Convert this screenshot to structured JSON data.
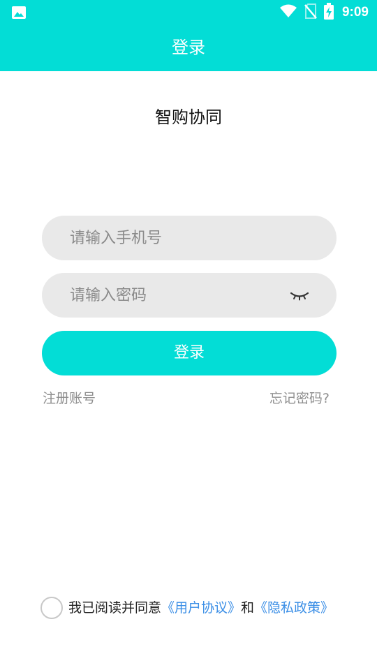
{
  "status_bar": {
    "time": "9:09",
    "left_icon": "image-icon",
    "icons": [
      "wifi-icon",
      "no-sim-icon",
      "battery-charging-icon"
    ]
  },
  "header": {
    "title": "登录"
  },
  "app": {
    "name": "智购协同"
  },
  "form": {
    "phone_placeholder": "请输入手机号",
    "phone_value": "",
    "password_placeholder": "请输入密码",
    "password_value": "",
    "toggle_icon": "eye-closed-icon",
    "login_label": "登录",
    "register_label": "注册账号",
    "forgot_label": "忘记密码?"
  },
  "agreement": {
    "prefix": "我已阅读并同意",
    "user_agreement": "《用户协议》",
    "conjunction": "和",
    "privacy_policy": "《隐私政策》",
    "checked": false
  },
  "colors": {
    "accent": "#03DDD6",
    "field_bg": "#E9E9E9",
    "link": "#3A8EE6",
    "muted_text": "#8f8f8f"
  }
}
